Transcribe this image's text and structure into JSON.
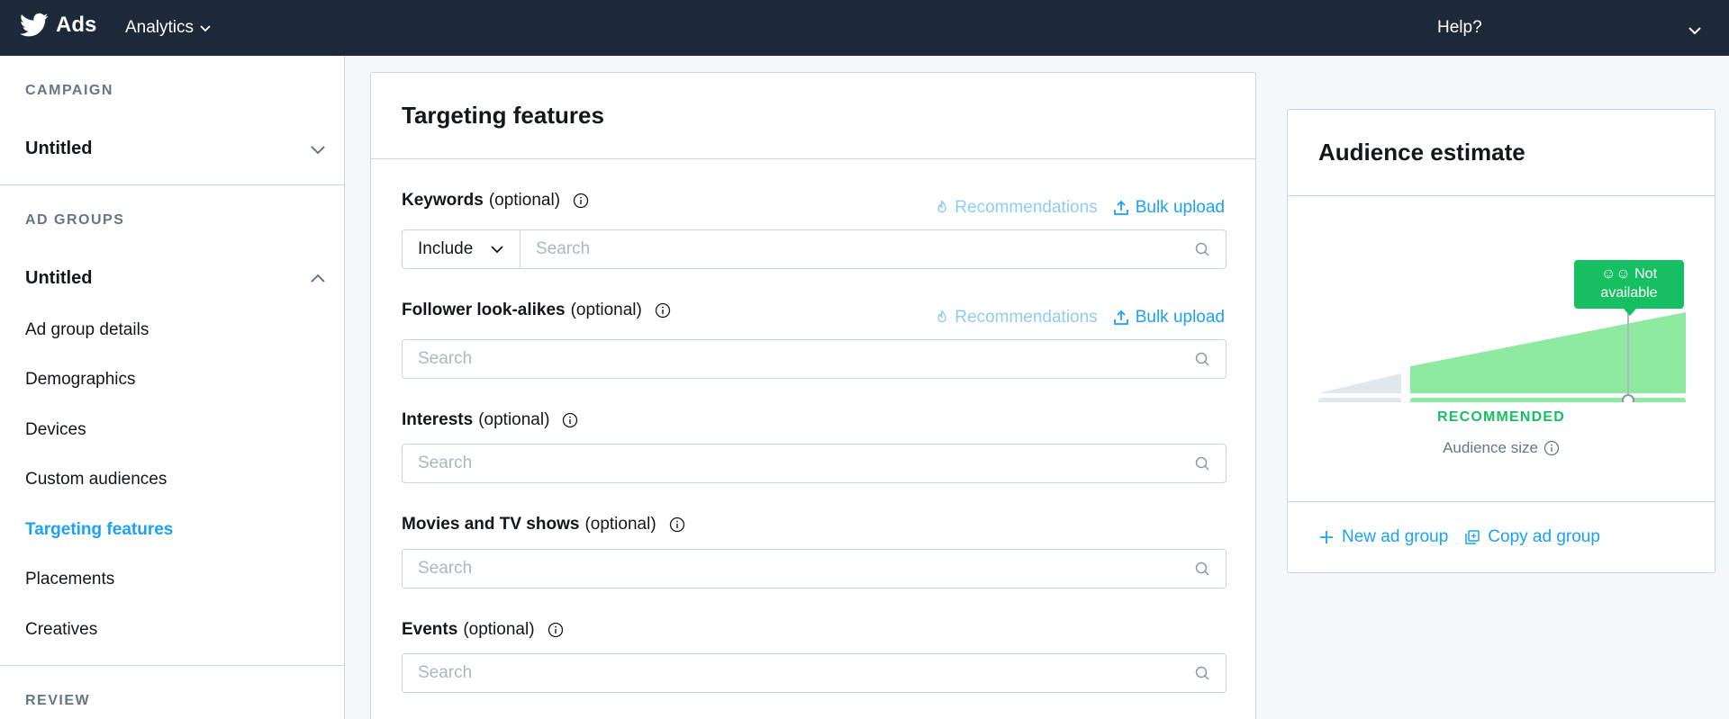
{
  "topbar": {
    "brand": "Ads",
    "analytics_label": "Analytics",
    "help_label": "Help?"
  },
  "sidebar": {
    "campaign_title": "CAMPAIGN",
    "campaign_name": "Untitled",
    "ad_groups_title": "AD GROUPS",
    "ad_group_name": "Untitled",
    "items": [
      {
        "label": "Ad group details"
      },
      {
        "label": "Demographics"
      },
      {
        "label": "Devices"
      },
      {
        "label": "Custom audiences"
      },
      {
        "label": "Targeting features",
        "active": true
      },
      {
        "label": "Placements"
      },
      {
        "label": "Creatives"
      }
    ],
    "review_title": "REVIEW"
  },
  "main": {
    "title": "Targeting features",
    "recommendations_label": "Recommendations",
    "bulk_upload_label": "Bulk upload",
    "include_label": "Include",
    "search_placeholder": "Search",
    "optional": "(optional)",
    "fields": [
      {
        "label": "Keywords"
      },
      {
        "label": "Follower look-alikes"
      },
      {
        "label": "Interests"
      },
      {
        "label": "Movies and TV shows"
      },
      {
        "label": "Events"
      }
    ]
  },
  "audience": {
    "title": "Audience estimate",
    "tooltip_line1": "Not",
    "tooltip_line2": "available",
    "recommended_label": "RECOMMENDED",
    "size_label": "Audience size",
    "new_group_label": "New ad group",
    "copy_group_label": "Copy ad group"
  },
  "colors": {
    "topbar": "#1c2938",
    "accent": "#1da1f2",
    "recommended": "#17bf63",
    "gauge_fill": "#8ee9a1"
  }
}
